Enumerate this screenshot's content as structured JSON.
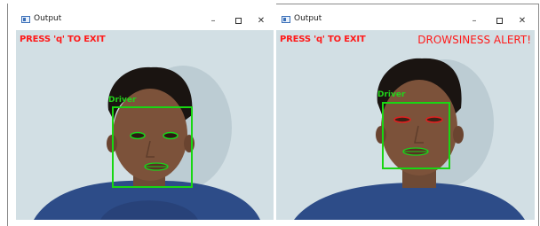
{
  "windows": [
    {
      "title": "Output",
      "controls": {
        "minimize": "–",
        "close": "✕"
      },
      "overlay_exit": "PRESS 'q' TO EXIT",
      "overlay_alert": "",
      "face_label": "Driver",
      "eyes_closed": false
    },
    {
      "title": "Output",
      "controls": {
        "minimize": "–",
        "close": "✕"
      },
      "overlay_exit": "PRESS 'q' TO EXIT",
      "overlay_alert": "DROWSINESS ALERT!",
      "face_label": "Driver",
      "eyes_closed": true
    }
  ],
  "colors": {
    "overlay_text": "#ff1a1a",
    "detection_box": "#19d613",
    "eye_open_contour": "#1bd31b",
    "eye_closed_contour": "#e02020",
    "background_wall": "#c7d6dd"
  }
}
